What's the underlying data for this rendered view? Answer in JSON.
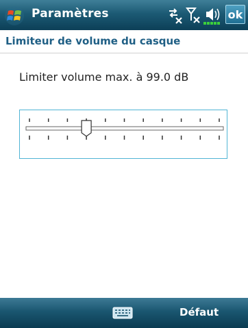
{
  "titlebar": {
    "app_title": "Paramètres",
    "ok_label": "ok",
    "icons": [
      "start-menu-icon",
      "connectivity-off-icon",
      "signal-off-icon",
      "speaker-volume-icon"
    ]
  },
  "header": {
    "title": "Limiteur de volume du casque"
  },
  "main": {
    "volume_label": "Limiter volume max. à 99.0 dB",
    "slider": {
      "tick_count": 11,
      "position_index": 3
    }
  },
  "bottombar": {
    "right_softkey": "Défaut",
    "center_icon": "keyboard-icon"
  },
  "colors": {
    "bar": "#1c5a74",
    "header_text": "#1f5f85",
    "slider_border": "#4fb4d4",
    "battery_green": "#3ccf3c"
  }
}
